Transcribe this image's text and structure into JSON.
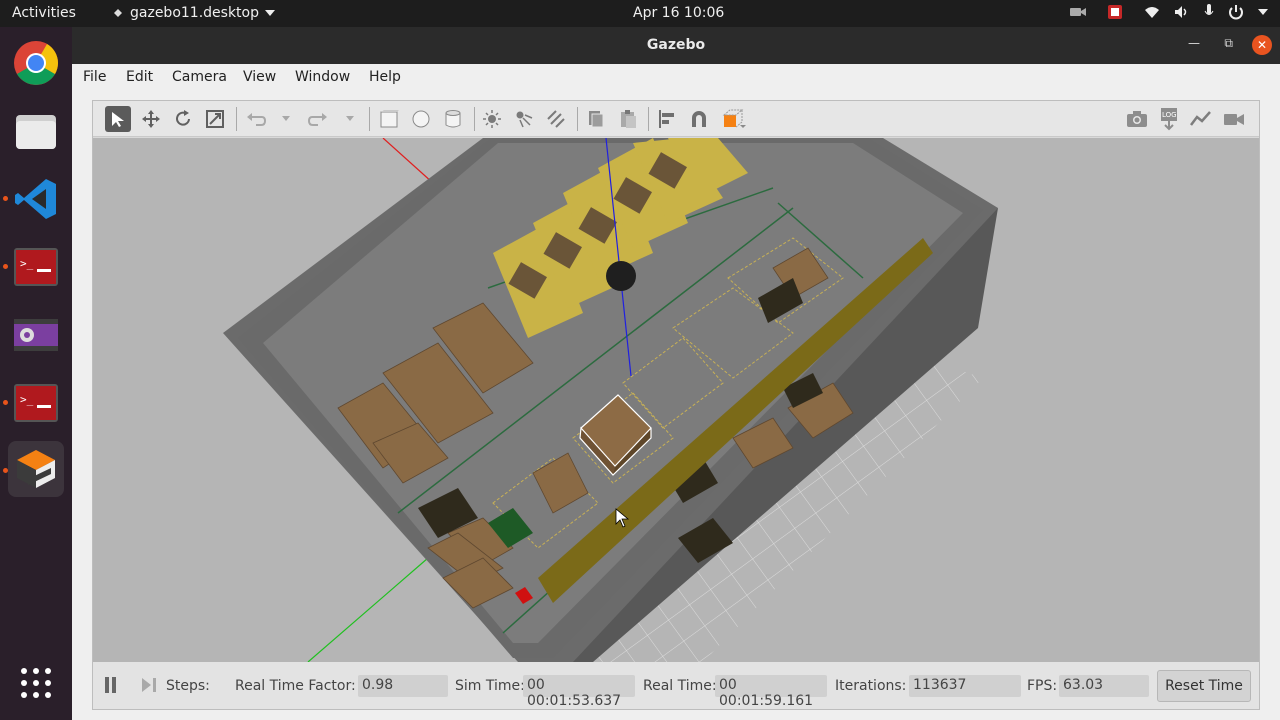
{
  "topbar": {
    "activities": "Activities",
    "app_menu": "gazebo11.desktop",
    "clock": "Apr 16  10:06"
  },
  "dock": {
    "items": [
      "chrome-icon",
      "files-icon",
      "vscode-icon",
      "terminal-icon",
      "webcam-icon",
      "terminal-icon",
      "gazebo-icon"
    ]
  },
  "window": {
    "title": "Gazebo",
    "menu": [
      "File",
      "Edit",
      "Camera",
      "View",
      "Window",
      "Help"
    ]
  },
  "toolbar": {
    "tools": [
      "select-mode",
      "translate-mode",
      "rotate-mode",
      "scale-mode",
      "undo",
      "redo",
      "box",
      "sphere",
      "cylinder",
      "point-light",
      "spot-light",
      "directional-light",
      "copy",
      "paste",
      "align",
      "snap",
      "view-angle"
    ],
    "right_tools": [
      "screenshot",
      "log",
      "plot",
      "record"
    ]
  },
  "statusbar": {
    "steps_label": "Steps:",
    "rtf_label": "Real Time Factor:",
    "rtf_value": "0.98",
    "sim_time_label": "Sim Time:",
    "sim_time_value": "00 00:01:53.637",
    "real_time_label": "Real Time:",
    "real_time_value": "00 00:01:59.161",
    "iterations_label": "Iterations:",
    "iterations_value": "113637",
    "fps_label": "FPS:",
    "fps_value": "63.03",
    "reset_label": "Reset Time"
  }
}
